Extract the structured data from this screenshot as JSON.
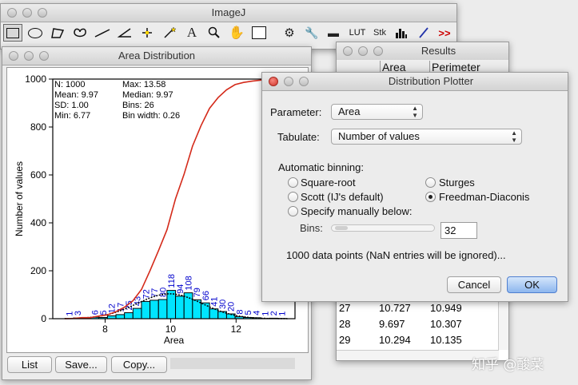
{
  "imagej": {
    "title": "ImageJ",
    "tools": [
      "rectangle-tool",
      "oval-tool",
      "polygon-tool",
      "freehand-tool",
      "straight-line-tool",
      "angle-tool",
      "point-tool",
      "wand-tool",
      "text-tool",
      "magnifying-glass-tool",
      "scrolling-tool",
      "color-picker-tool",
      "developer-menu-tool",
      "stacking-tools",
      "lut-menu",
      "stk-menu",
      "brush-tool",
      "pencil-tool",
      "more-tools-menu"
    ],
    "lut_label": "LUT",
    "stk_label": "Stk",
    "more_label": ">>",
    "text_tool_label": "A"
  },
  "results": {
    "title": "Results",
    "columns": [
      "",
      "Area",
      "Perimeter"
    ],
    "rows": [
      [
        "27",
        "10.727",
        "10.949"
      ],
      [
        "28",
        "9.697",
        "10.307"
      ],
      [
        "29",
        "10.294",
        "10.135"
      ]
    ]
  },
  "distribution": {
    "title": "Area Distribution",
    "stats_left": [
      "N: 1000",
      "Mean: 9.97",
      "SD: 1.00",
      "Min: 6.77"
    ],
    "stats_right": [
      "Max: 13.58",
      "Median: 9.97",
      "Bins: 26",
      "Bin width: 0.26"
    ],
    "buttons": {
      "list": "List",
      "save": "Save...",
      "copy": "Copy..."
    }
  },
  "chart_data": {
    "type": "bar",
    "xlabel": "Area",
    "ylabel": "Number of values",
    "xlim": [
      6.77,
      13.58
    ],
    "ylim": [
      0,
      1000
    ],
    "xticks": [
      "8",
      "10",
      "12"
    ],
    "yticks": [
      "0",
      "200",
      "400",
      "600",
      "800",
      "1000"
    ],
    "bin_start": 6.77,
    "bin_width": 0.26,
    "series": [
      {
        "values": [
          1,
          3,
          0,
          6,
          5,
          12,
          17,
          25,
          43,
          72,
          77,
          80,
          118,
          94,
          108,
          79,
          66,
          41,
          30,
          20,
          8,
          5,
          4,
          1,
          2,
          1
        ]
      }
    ],
    "data_labels": [
      "1",
      "3",
      "",
      "6",
      "5",
      "12",
      "17",
      "25",
      "43",
      "72",
      "77",
      "80",
      "118",
      "94",
      "108",
      "79",
      "66",
      "41",
      "30",
      "20",
      "8",
      "5",
      "4",
      "1",
      "2",
      "1"
    ],
    "bar_color": "#00e5ff",
    "label_color": "#0000cc",
    "overlays": [
      "normal-fit-curve-dotted-black",
      "cumulative-distribution-red"
    ],
    "grid": false
  },
  "plotter": {
    "title": "Distribution Plotter",
    "parameter_label": "Parameter:",
    "parameter_value": "Area",
    "tabulate_label": "Tabulate:",
    "tabulate_value": "Number of values",
    "binning_label": "Automatic binning:",
    "options": {
      "square_root": "Square-root",
      "scott": "Scott (IJ's default)",
      "specify": "Specify manually below:",
      "sturges": "Sturges",
      "fd": "Freedman-Diaconis"
    },
    "selected_option": "Freedman-Diaconis",
    "bins_label": "Bins:",
    "bins_value": "32",
    "info": "1000 data points (NaN entries will be ignored)...",
    "cancel": "Cancel",
    "ok": "OK"
  },
  "watermark": "知乎 @酸菜"
}
